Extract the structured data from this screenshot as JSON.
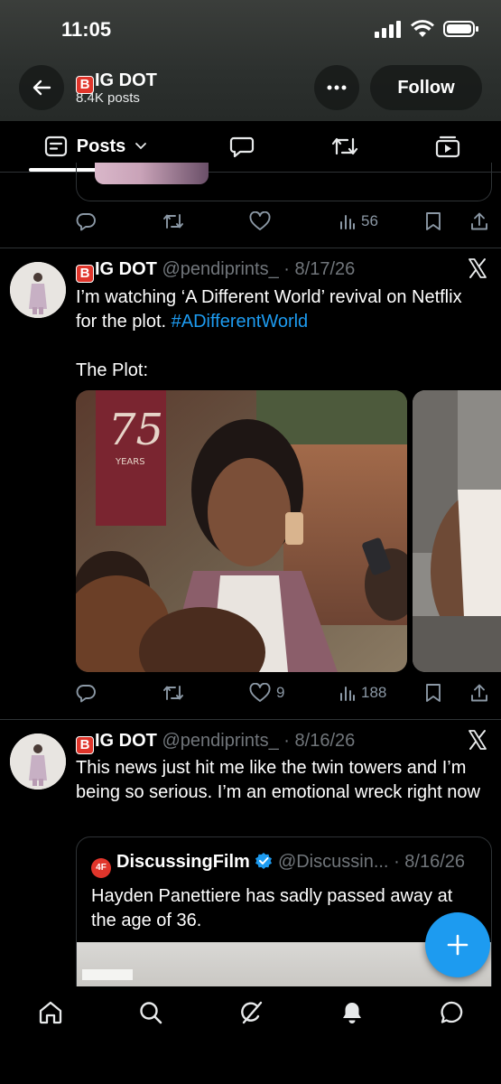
{
  "status": {
    "time": "11:05"
  },
  "header": {
    "badge_letter": "B",
    "name_rest": "IG DOT",
    "posts_count": "8.4K posts",
    "follow_label": "Follow"
  },
  "tabs": {
    "posts_label": "Posts"
  },
  "prev_post": {
    "views": "56"
  },
  "posts": [
    {
      "badge_letter": "B",
      "name_rest": "IG DOT",
      "handle": "@pendiprints_",
      "date": "· 8/17/26",
      "text_line1": "I’m watching ‘A Different World’ revival on Netflix",
      "text_line2_prefix": "for the plot. ",
      "hashtag": "#ADifferentWorld",
      "text_line3": "The Plot:",
      "sign_number": "75",
      "sign_word": "YEARS",
      "likes": "9",
      "views": "188"
    },
    {
      "badge_letter": "B",
      "name_rest": "IG DOT",
      "handle": "@pendiprints_",
      "date": "· 8/16/26",
      "text": "This news just hit me like the twin towers and I’m being so serious. I’m an emotional wreck right now",
      "quote": {
        "logo_text": "4F",
        "name": "DiscussingFilm",
        "handle": "@Discussin...",
        "date": "· 8/16/26",
        "text": "Hayden Panettiere has sadly passed away at the age of 36."
      }
    }
  ],
  "fab_label": "+",
  "colors": {
    "accent": "#1d9bf0",
    "badge": "#e0352b",
    "background": "#000000"
  }
}
